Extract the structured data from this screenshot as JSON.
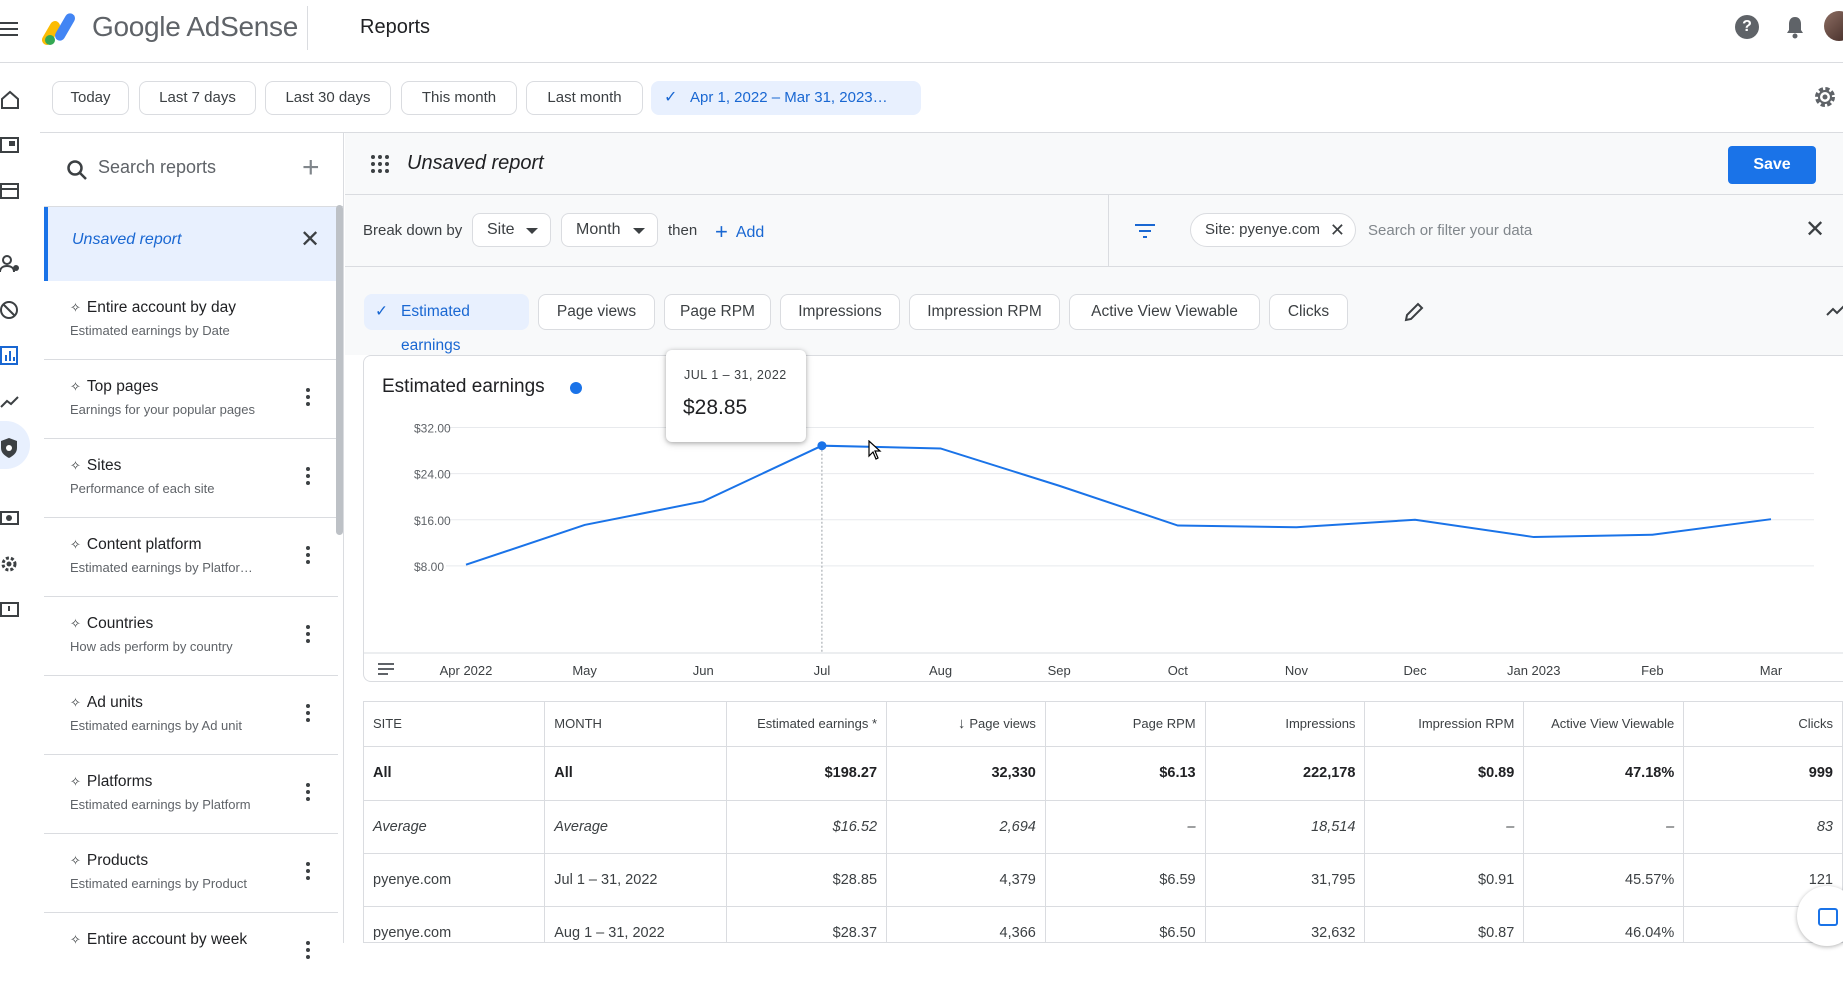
{
  "app": {
    "brand": "Google AdSense",
    "page_title": "Reports"
  },
  "date_ranges": [
    "Today",
    "Last 7 days",
    "Last 30 days",
    "This month",
    "Last month"
  ],
  "date_custom": "Apr 1, 2022 – Mar 31, 2023…",
  "report_panel": {
    "search_placeholder": "Search reports",
    "active_report": "Unsaved report",
    "items": [
      {
        "title": "Entire account by day",
        "subtitle": "Estimated earnings by Date"
      },
      {
        "title": "Top pages",
        "subtitle": "Earnings for your popular pages"
      },
      {
        "title": "Sites",
        "subtitle": "Performance of each site"
      },
      {
        "title": "Content platform",
        "subtitle": "Estimated earnings by Platfor…"
      },
      {
        "title": "Countries",
        "subtitle": "How ads perform by country"
      },
      {
        "title": "Ad units",
        "subtitle": "Estimated earnings by Ad unit"
      },
      {
        "title": "Platforms",
        "subtitle": "Estimated earnings by Platform"
      },
      {
        "title": "Products",
        "subtitle": "Estimated earnings by Product"
      },
      {
        "title": "Entire account by week",
        "subtitle": ""
      }
    ]
  },
  "report_header": {
    "name": "Unsaved report",
    "save_label": "Save"
  },
  "breakdown": {
    "label": "Break down by",
    "dim1": "Site",
    "dim2": "Month",
    "then": "then",
    "add": "Add",
    "filter_chip": "Site: pyenye.com",
    "filter_placeholder": "Search or filter your data"
  },
  "metrics": [
    "Estimated earnings",
    "Page views",
    "Page RPM",
    "Impressions",
    "Impression RPM",
    "Active View Viewable",
    "Clicks"
  ],
  "chart_data": {
    "type": "line",
    "title": "Estimated earnings",
    "categories": [
      "Apr 2022",
      "May",
      "Jun",
      "Jul",
      "Aug",
      "Sep",
      "Oct",
      "Nov",
      "Dec",
      "Jan 2023",
      "Feb",
      "Mar"
    ],
    "series": [
      {
        "values": [
          8.2,
          15.1,
          19.2,
          28.85,
          28.37,
          21.9,
          15.0,
          14.7,
          16.0,
          13.0,
          13.4,
          16.1
        ]
      }
    ],
    "yticks": [
      "$8.00",
      "$16.00",
      "$24.00",
      "$32.00"
    ],
    "ylim": [
      0,
      34
    ],
    "grid": true,
    "highlight_index": 3,
    "color": "#1a73e8"
  },
  "tooltip": {
    "date": "JUL 1 – 31, 2022",
    "value": "$28.85"
  },
  "table": {
    "headers": [
      "SITE",
      "MONTH",
      "Estimated earnings *",
      "Page views",
      "Page RPM",
      "Impressions",
      "Impression RPM",
      "Active View Viewable",
      "Clicks"
    ],
    "total": [
      "All",
      "All",
      "$198.27",
      "32,330",
      "$6.13",
      "222,178",
      "$0.89",
      "47.18%",
      "999"
    ],
    "average": [
      "Average",
      "Average",
      "$16.52",
      "2,694",
      "–",
      "18,514",
      "–",
      "–",
      "83"
    ],
    "rows": [
      [
        "pyenye.com",
        "Jul 1 – 31, 2022",
        "$28.85",
        "4,379",
        "$6.59",
        "31,795",
        "$0.91",
        "45.57%",
        "121"
      ],
      [
        "pyenye.com",
        "Aug 1 – 31, 2022",
        "$28.37",
        "4,366",
        "$6.50",
        "32,632",
        "$0.87",
        "46.04%",
        ""
      ]
    ]
  }
}
